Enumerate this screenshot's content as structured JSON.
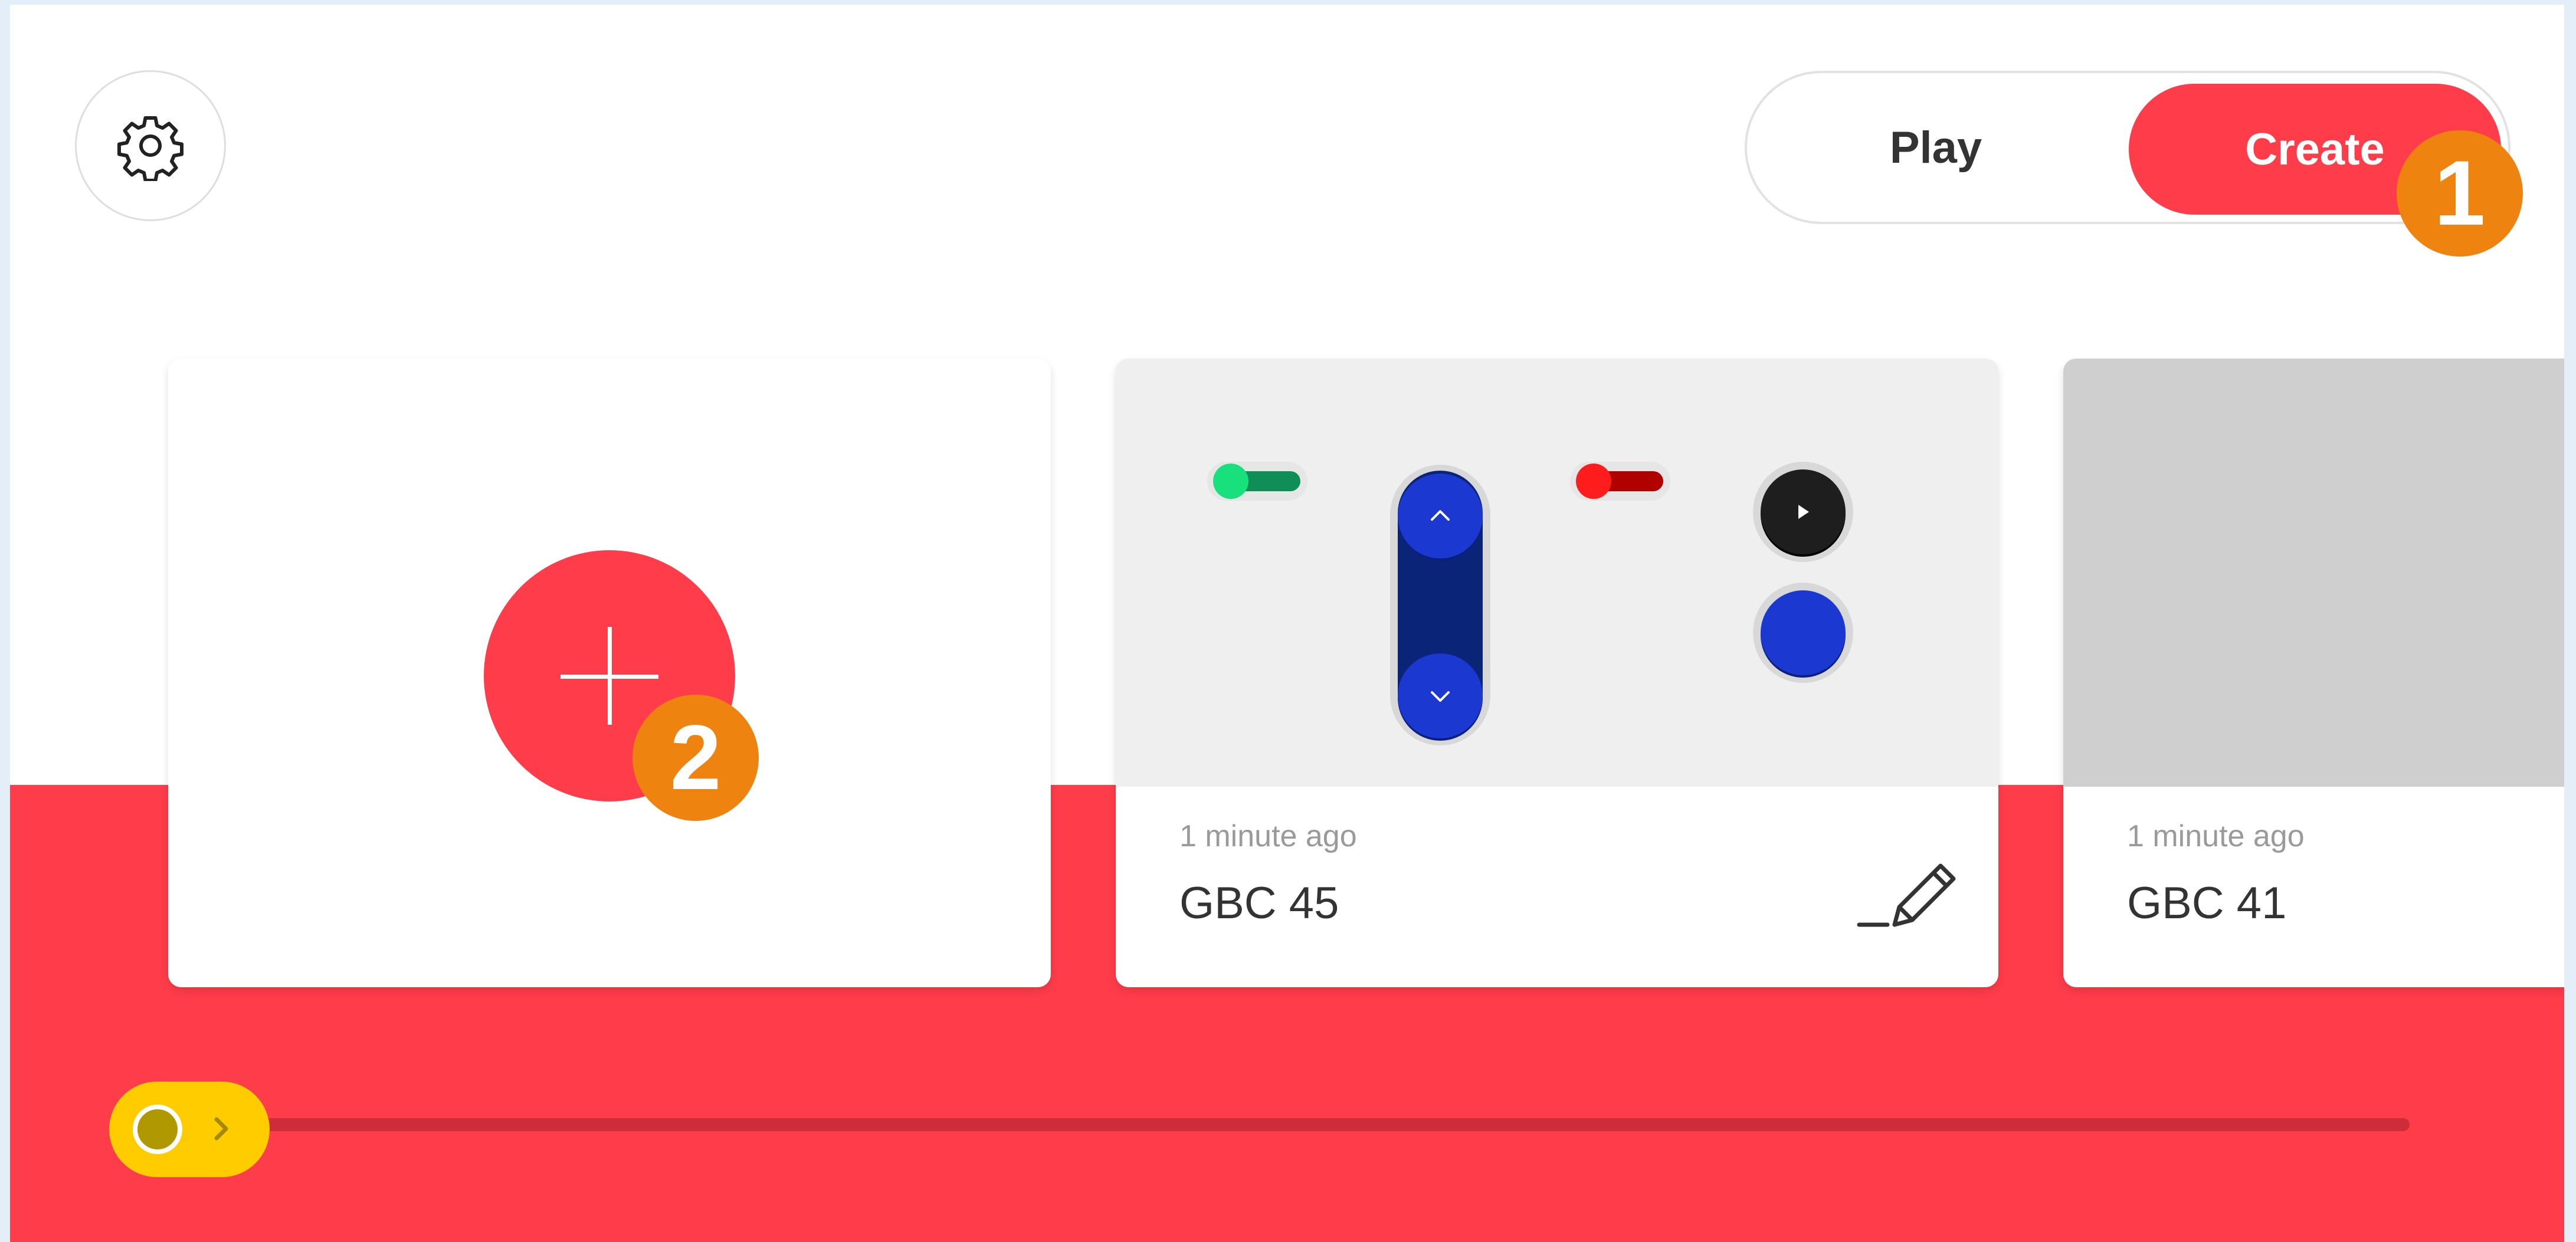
{
  "toolbar": {
    "settings_icon": "gear-icon",
    "mode_toggle": {
      "play_label": "Play",
      "create_label": "Create",
      "selected": "Create"
    }
  },
  "annotations": {
    "step_1": "1",
    "step_2": "2",
    "badge_color": "#ee8310"
  },
  "projects": {
    "new_project_icon": "plus-icon",
    "items": [
      {
        "time": "1 minute ago",
        "title": "GBC 45",
        "edit_icon": "pencil-icon",
        "thumbnail": "gamepad-layout"
      },
      {
        "time": "1 minute ago",
        "title": "GBC 41",
        "thumbnail": "blank"
      }
    ]
  },
  "colors": {
    "accent": "#ff3c4a",
    "scroll_thumb": "#ffcc00",
    "control_blue": "#1b38d0"
  },
  "scroll": {
    "position": 0
  }
}
